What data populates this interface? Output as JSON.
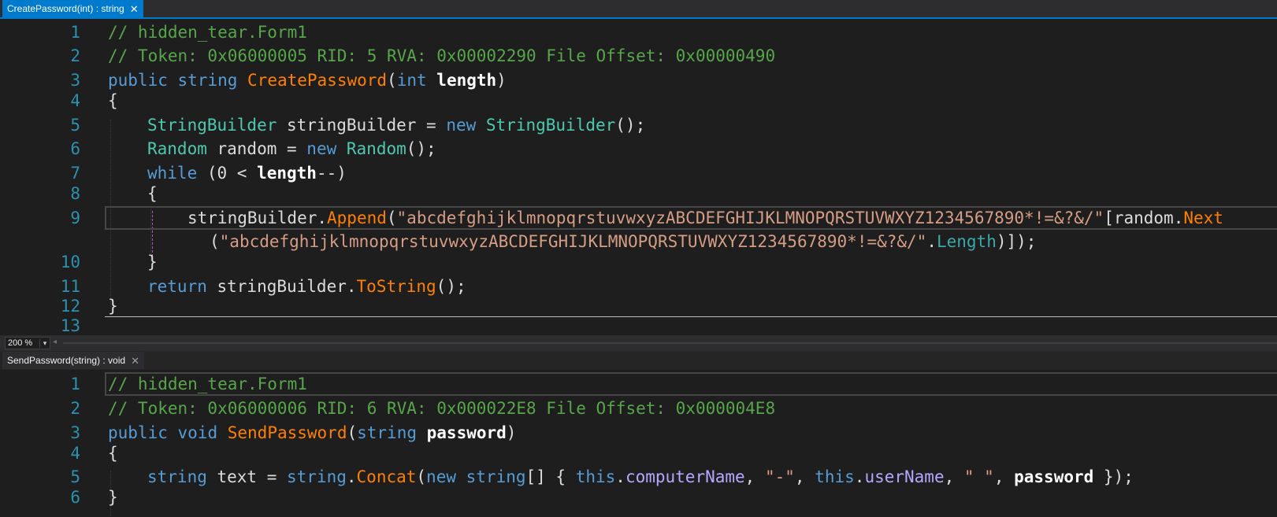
{
  "top_pane": {
    "tab_title": "CreatePassword(int) : string",
    "close_glyph": "✕",
    "lines": [
      {
        "n": "1"
      },
      {
        "n": "2"
      },
      {
        "n": "3"
      },
      {
        "n": "4"
      },
      {
        "n": "5"
      },
      {
        "n": "6"
      },
      {
        "n": "7"
      },
      {
        "n": "8"
      },
      {
        "n": "9"
      },
      {
        "n": "10"
      },
      {
        "n": "11"
      },
      {
        "n": "12"
      },
      {
        "n": "13"
      }
    ],
    "tokens": {
      "l1": "// hidden_tear.Form1",
      "l2": "// Token: 0x06000005 RID: 5 RVA: 0x00002290 File Offset: 0x00000490",
      "l3_kw1": "public",
      "l3_kw2": "string",
      "l3_method": "CreatePassword",
      "l3_open": "(",
      "l3_kw3": "int",
      "l3_param": "length",
      "l3_close": ")",
      "l4": "{",
      "l5_type1": "StringBuilder",
      "l5_mid": " stringBuilder = ",
      "l5_kw": "new",
      "l5_type2": "StringBuilder",
      "l5_end": "();",
      "l6_type1": "Random",
      "l6_mid": " random = ",
      "l6_kw": "new",
      "l6_type2": "Random",
      "l6_end": "();",
      "l7_kw": "while",
      "l7_mid": " (0 < ",
      "l7_param": "length",
      "l7_end": "--)",
      "l8": "{",
      "l9_obj": "stringBuilder.",
      "l9_method": "Append",
      "l9_open": "(",
      "l9_str": "\"abcdefghijklmnopqrstuvwxyzABCDEFGHIJKLMNOPQRSTUVWXYZ1234567890*!=&?&/\"",
      "l9_mid": "[random.",
      "l9_method2": "Next",
      "l9b_open": "(",
      "l9b_str": "\"abcdefghijklmnopqrstuvwxyzABCDEFGHIJKLMNOPQRSTUVWXYZ1234567890*!=&?&/\"",
      "l9b_dot": ".",
      "l9b_prop": "Length",
      "l9b_end": ")]);",
      "l10": "}",
      "l11_kw": "return",
      "l11_mid": " stringBuilder.",
      "l11_method": "ToString",
      "l11_end": "();",
      "l12": "}"
    }
  },
  "zoom": {
    "value": "200 %",
    "dropdown_glyph": "▾",
    "scroll_left_glyph": "◂"
  },
  "bottom_pane": {
    "tab_title": "SendPassword(string) : void",
    "close_glyph": "✕",
    "lines": [
      {
        "n": "1"
      },
      {
        "n": "2"
      },
      {
        "n": "3"
      },
      {
        "n": "4"
      },
      {
        "n": "5"
      },
      {
        "n": "6"
      }
    ],
    "tokens": {
      "l1": "// hidden_tear.Form1",
      "l2": "// Token: 0x06000006 RID: 6 RVA: 0x000022E8 File Offset: 0x000004E8",
      "l3_kw1": "public",
      "l3_kw2": "void",
      "l3_method": "SendPassword",
      "l3_open": "(",
      "l3_kw3": "string",
      "l3_param": "password",
      "l3_close": ")",
      "l4": "{",
      "l5_kw1": "string",
      "l5_mid": " text = ",
      "l5_kw2": "string",
      "l5_dot": ".",
      "l5_method": "Concat",
      "l5_open": "(",
      "l5_kw3": "new",
      "l5_kw4": "string",
      "l5_arr": "[] { ",
      "l5_this1": "this",
      "l5_dot2": ".",
      "l5_field1": "computerName",
      "l5_comma1": ", ",
      "l5_str1": "\"-\"",
      "l5_comma2": ", ",
      "l5_this2": "this",
      "l5_dot3": ".",
      "l5_field2": "userName",
      "l5_comma3": ", ",
      "l5_str2": "\" \"",
      "l5_comma4": ", ",
      "l5_param": "password",
      "l5_end": " });",
      "l6": "}"
    }
  }
}
